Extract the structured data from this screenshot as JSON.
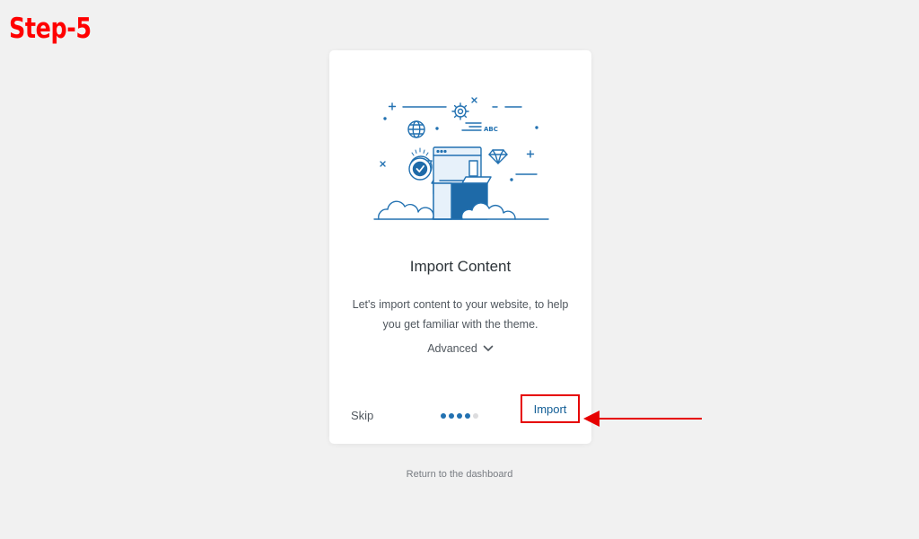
{
  "annotation": {
    "step_label": "Step-5",
    "highlight_color": "#ff0000"
  },
  "card": {
    "title": "Import Content",
    "description": "Let's import content to your website, to help you get familiar with the theme.",
    "advanced_label": "Advanced",
    "advanced_icon": "chevron-down-icon",
    "illustration_label": "ABC",
    "illustration_icons": [
      "gear-icon",
      "globe-icon",
      "diamond-icon",
      "checkmark-badge-icon",
      "browser-window-icon",
      "box-icon",
      "cloud-icon"
    ]
  },
  "footer": {
    "skip_label": "Skip",
    "import_label": "Import",
    "progress": {
      "total_steps": 5,
      "current_step": 4
    }
  },
  "return_link": "Return to the dashboard",
  "colors": {
    "accent": "#2271b1",
    "background": "#f1f1f1",
    "card": "#ffffff"
  }
}
